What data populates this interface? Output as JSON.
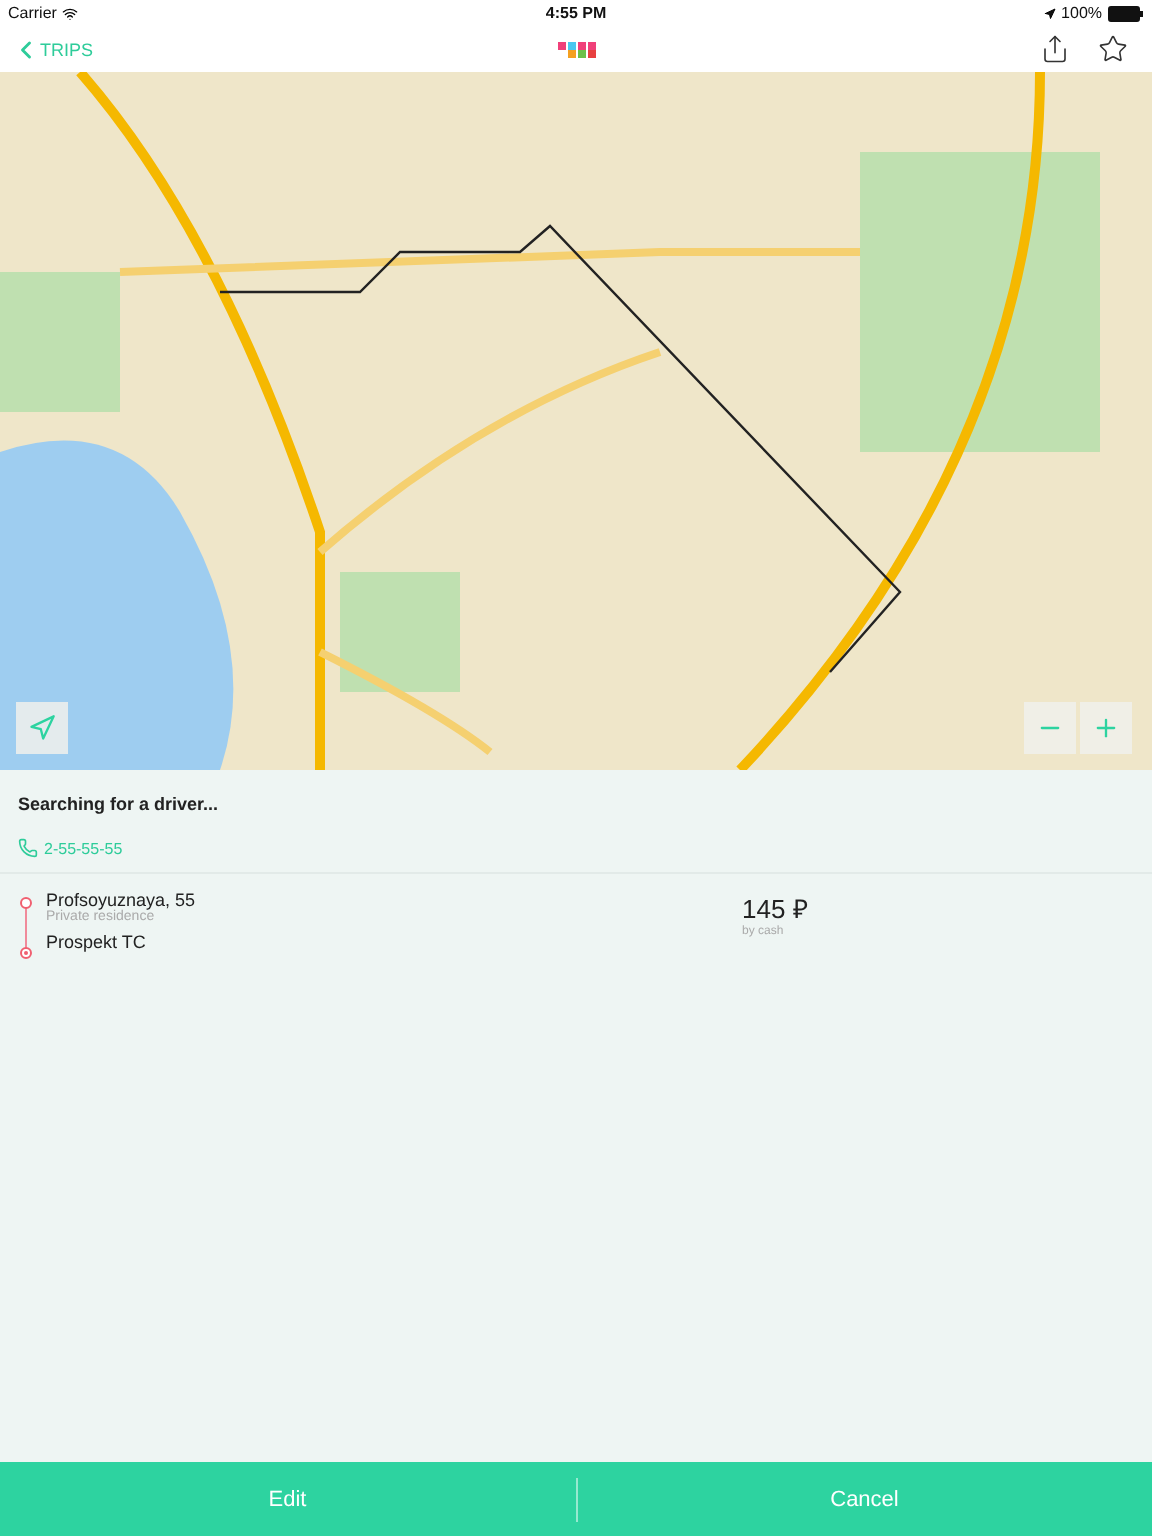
{
  "status_bar": {
    "carrier": "Carrier",
    "time": "4:55 PM",
    "battery": "100%"
  },
  "nav_bar": {
    "back_label": "TRIPS"
  },
  "trip": {
    "status": "Searching for a driver...",
    "phone": "2-55-55-55",
    "stops": [
      {
        "kind": "pickup",
        "name": "Profsoyuznaya, 55",
        "note": "Private residence"
      },
      {
        "kind": "dropoff",
        "name": "Prospekt TC"
      }
    ],
    "price": "145 ₽",
    "payment": "by cash"
  },
  "buttons": [
    {
      "label": "Edit"
    },
    {
      "label": "Cancel"
    }
  ]
}
